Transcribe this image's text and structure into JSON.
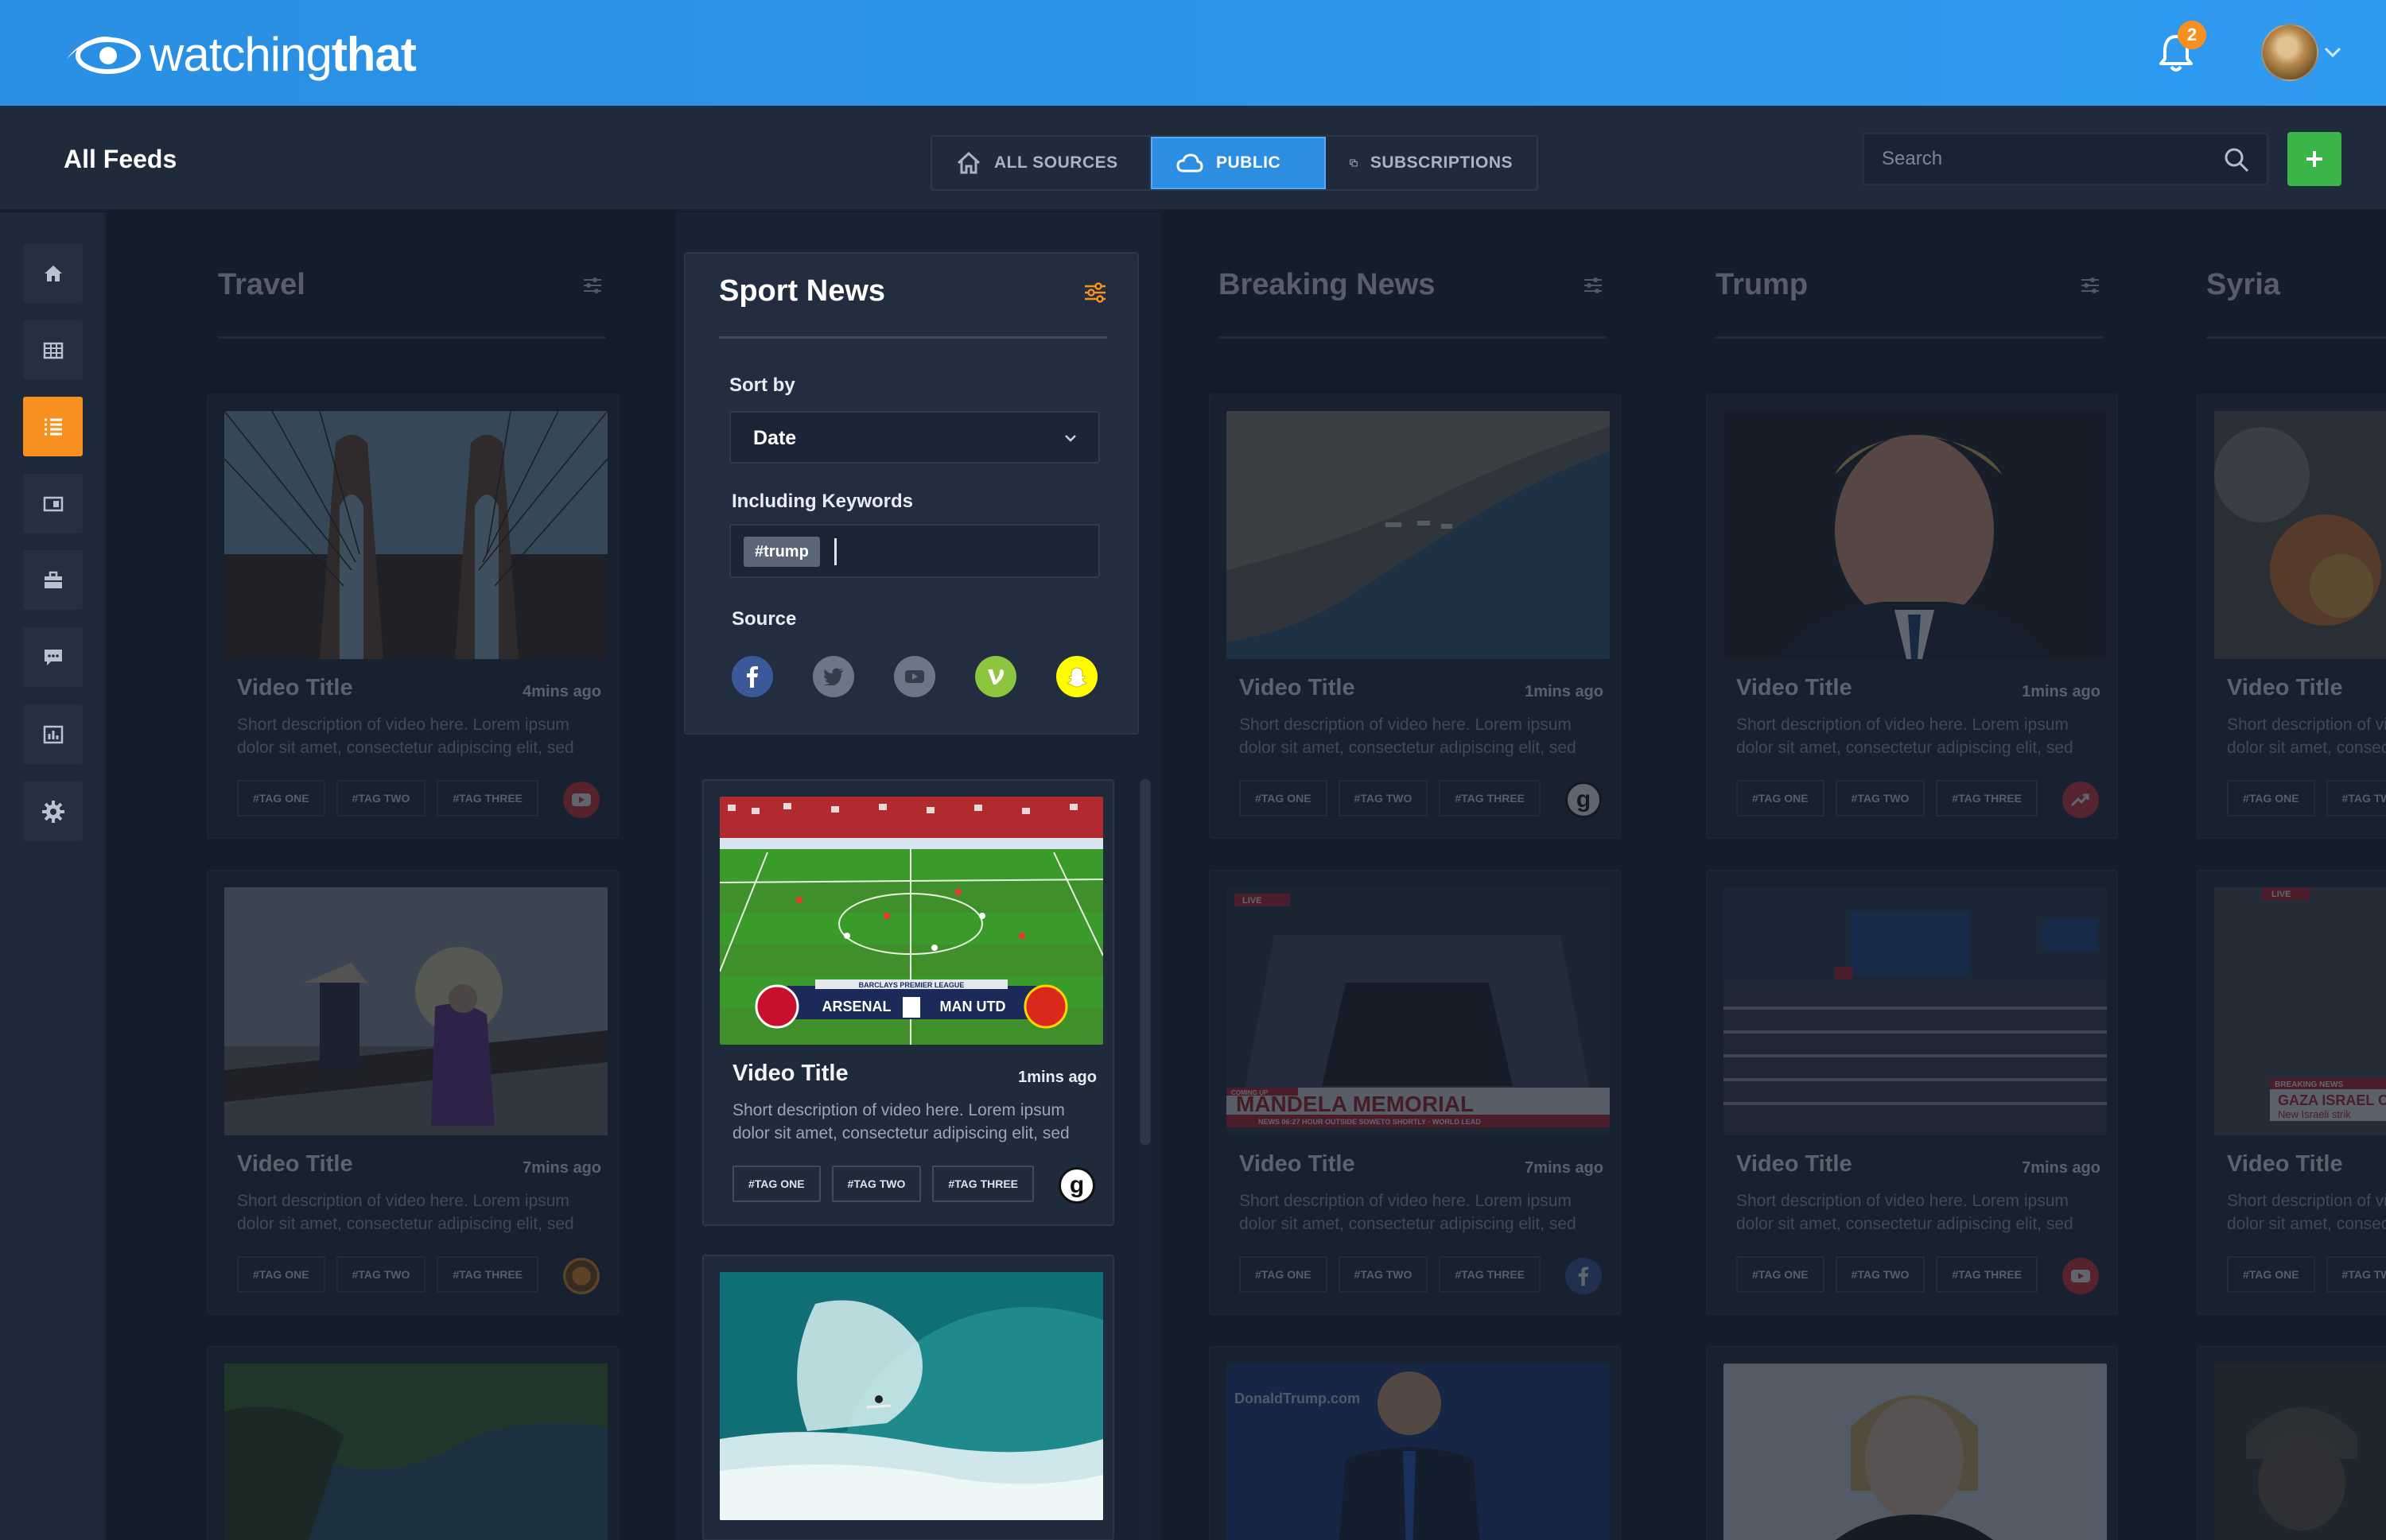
{
  "app": {
    "brand_light": "watching",
    "brand_bold": "that",
    "notification_count": "2"
  },
  "header": {
    "page_title": "All Feeds",
    "tabs": [
      {
        "label": "ALL SOURCES",
        "icon": "home-icon"
      },
      {
        "label": "PUBLIC",
        "icon": "cloud-icon",
        "active": true
      },
      {
        "label": "SUBSCRIPTIONS",
        "icon": "copy-icon"
      }
    ],
    "search": {
      "placeholder": "Search",
      "value": ""
    }
  },
  "sidebar": {
    "items": [
      {
        "icon": "home-icon"
      },
      {
        "icon": "grid-icon"
      },
      {
        "icon": "list-icon",
        "active": true
      },
      {
        "icon": "layout-icon"
      },
      {
        "icon": "briefcase-icon"
      },
      {
        "icon": "chat-icon"
      },
      {
        "icon": "bar-chart-icon"
      },
      {
        "icon": "gear-icon"
      }
    ]
  },
  "filter_panel": {
    "title": "Sport News",
    "sort_label": "Sort by",
    "sort_value": "Date",
    "keywords_label": "Including Keywords",
    "keyword_chip": "#trump",
    "source_label": "Source",
    "sources": [
      "facebook",
      "twitter",
      "youtube",
      "vine",
      "snapchat"
    ]
  },
  "columns": [
    {
      "title": "Travel",
      "cards": [
        {
          "title": "Video Title",
          "time": "4mins ago",
          "source": "youtube"
        },
        {
          "title": "Video Title",
          "time": "7mins ago",
          "source": "generic"
        }
      ]
    },
    {
      "title": "Sport News",
      "cards": [
        {
          "title": "Video Title",
          "time": "1mins ago",
          "source": "g"
        }
      ]
    },
    {
      "title": "Breaking News",
      "cards": [
        {
          "title": "Video Title",
          "time": "1mins ago",
          "source": "g"
        },
        {
          "title": "Video Title",
          "time": "7mins ago",
          "source": "facebook"
        }
      ]
    },
    {
      "title": "Trump",
      "cards": [
        {
          "title": "Video Title",
          "time": "1mins ago",
          "source": "trending"
        },
        {
          "title": "Video Title",
          "time": "7mins ago",
          "source": "youtube"
        }
      ]
    },
    {
      "title": "Syria",
      "cards": [
        {
          "title": "Video Title"
        },
        {
          "title": "Video Title"
        }
      ]
    }
  ],
  "card_common": {
    "description": "Short description of video here. Lorem ipsum dolor sit amet, consectetur adipiscing elit, sed",
    "tags": [
      "#TAG ONE",
      "#TAG TWO",
      "#TAG THREE"
    ]
  },
  "thumb_text": {
    "league": "BARCLAYS PREMIER LEAGUE",
    "home_team": "ARSENAL",
    "away_team": "MAN UTD",
    "news_coming_up": "COMING UP",
    "news_headline": "MANDELA MEMORIAL",
    "news_ticker": "NEWS 06:27 HOUR OUTSIDE SOWETO SHORTLY · WORLD LEAD",
    "breaking_label": "BREAKING NEWS",
    "breaking_headline": "GAZA ISRAEL C",
    "breaking_sub": "New Israeli strik",
    "live_label": "LIVE",
    "sign_text": "DonaldTrump.com"
  },
  "colors": {
    "accent": "#f7901e",
    "primary": "#2b8ee0",
    "success": "#3bb54a",
    "bg": "#141d2b"
  }
}
